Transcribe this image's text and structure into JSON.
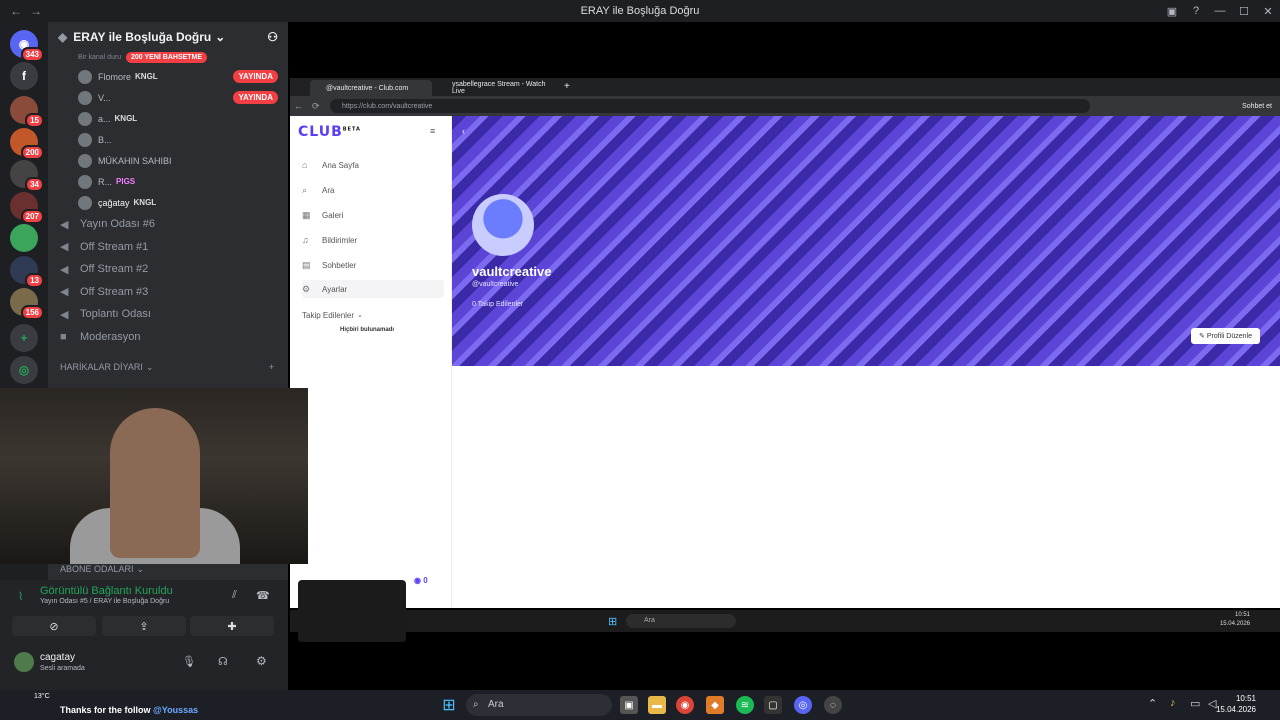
{
  "window": {
    "title": "ERAY ile Boşluğa Doğru"
  },
  "rail": {
    "servers": [
      {
        "icon": "discord-icon",
        "badge": "343"
      },
      {
        "icon": "f-icon",
        "badge": ""
      },
      {
        "badge": "15"
      },
      {
        "badge": "200"
      },
      {
        "badge": "34"
      },
      {
        "badge": "207"
      },
      {
        "badge": ""
      },
      {
        "badge": "13"
      },
      {
        "badge": "156"
      }
    ]
  },
  "sidebar": {
    "server_name": "ERAY ile Boşluğa Doğru",
    "channel_hint": "Bir kanal duru",
    "promo_badge": "200 YENİ BAHSETME",
    "voice_users": [
      {
        "name": "Flomore",
        "tag": "KNGL",
        "live": "YAYINDA"
      },
      {
        "name": "V...",
        "tag": "",
        "live": "YAYINDA"
      },
      {
        "name": "a...",
        "tag": "KNGL",
        "live": ""
      },
      {
        "name": "B...",
        "tag": "",
        "live": ""
      },
      {
        "name": "MÜKAHIN SAHIBI",
        "tag": "",
        "live": ""
      },
      {
        "name": "R...",
        "tag": "PIGS",
        "live": ""
      },
      {
        "name": "çağatay",
        "tag": "KNGL",
        "live": ""
      }
    ],
    "channels": [
      "Yayın Odası #6",
      "Off Stream #1",
      "Off Stream #2",
      "Off Stream #3",
      "Toplantı Odası",
      "Moderasyon"
    ],
    "category1": "HARİKALAR DİYARI",
    "category2": "ABONE ODALARI"
  },
  "voice": {
    "status": "Görüntülü Bağlantı Kuruldu",
    "location": "Yayın Odası #5 / ERAY ile Boşluğa Doğru",
    "user_name": "cagatay",
    "user_status": "Sesli aramada"
  },
  "browser": {
    "tabs": [
      "@vaultcreative - Club.com",
      "ysabellegrace Stream - Watch Live"
    ],
    "url": "https://club.com/vaultcreative",
    "side_btn": "Sohbet et",
    "logo": "CLUB",
    "logo_tag": "BETA",
    "nav": [
      "Ana Sayfa",
      "Ara",
      "Galeri",
      "Bildirimler",
      "Sohbetler",
      "Ayarlar"
    ],
    "following_label": "Takip Edilenler",
    "following_empty": "Hiçbiri bulunamadı",
    "profile_name": "vaultcreative",
    "profile_handle": "@vaultcreative",
    "profile_follow": "0 Takip Edilenler",
    "edit_profile": "Profili Düzenle",
    "inner_search": "Ara",
    "inner_time": "10:51",
    "inner_date": "15.04.2026",
    "chip_count": "0"
  },
  "taskbar": {
    "weather": "13°C",
    "ticker_text": "Thanks for the follow",
    "ticker_user": "@Youssas",
    "search_placeholder": "Ara",
    "time": "10:51",
    "date": "15.04.2026"
  }
}
